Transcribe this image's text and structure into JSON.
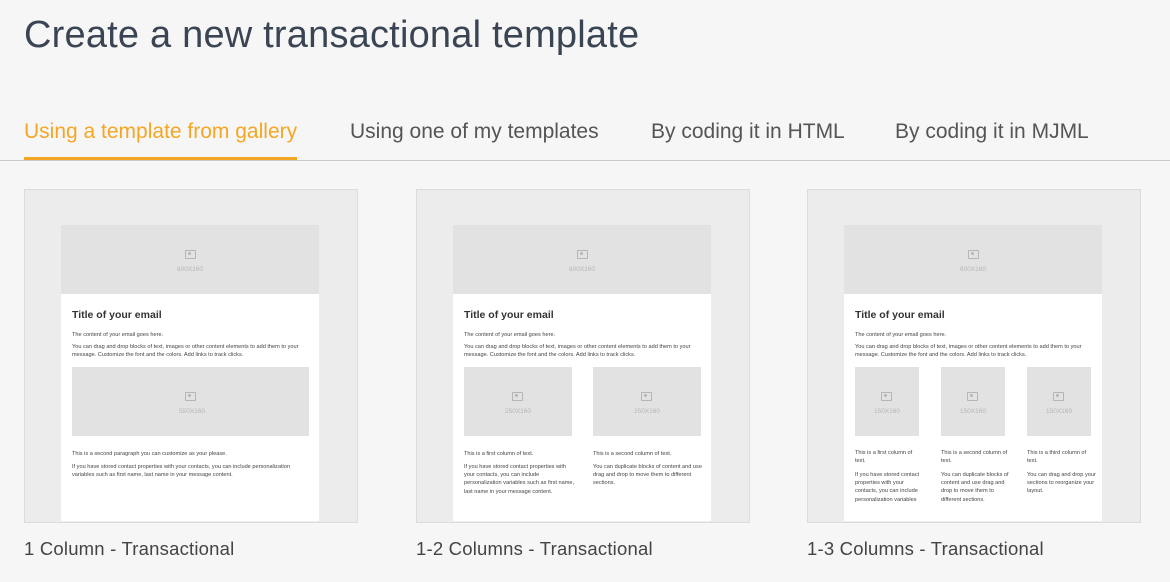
{
  "page": {
    "title": "Create a new transactional template"
  },
  "tabs": [
    {
      "label": "Using a template from gallery",
      "active": true
    },
    {
      "label": "Using one of my templates",
      "active": false
    },
    {
      "label": "By coding it in HTML",
      "active": false
    },
    {
      "label": "By coding it in MJML",
      "active": false
    }
  ],
  "colors": {
    "accent": "#f5a623",
    "title": "#3a4452"
  },
  "templates": [
    {
      "name": "1 Column - Transactional",
      "hero_size": "600X160",
      "email_title": "Title of your email",
      "intro": "The content of your email goes here.",
      "body": "You can drag and drop blocks of text, images or other content elements to add them to your message. Customize the font and the colors. Add links to track clicks.",
      "image_size": "550X160",
      "para2": "This is a second paragraph you can customize as your please.",
      "para3": "If you have stored contact properties with your contacts, you can include personalization variables such as first name, last name in your message content."
    },
    {
      "name": "1-2 Columns - Transactional",
      "hero_size": "600X160",
      "email_title": "Title of your email",
      "intro": "The content of your email goes here.",
      "body": "You can drag and drop blocks of text, images or other content elements to add them to your message. Customize the font and the colors. Add links to track clicks.",
      "col1_size": "250X160",
      "col2_size": "250X160",
      "col1_head": "This is a first column of text.",
      "col1_text": "If you have stored contact properties with your contacts, you can include personalization variables such as first name, last name in your message content.",
      "col2_head": "This is a second column of text.",
      "col2_text": "You can duplicate blocks of content and use drag and drop to move them to different sections."
    },
    {
      "name": "1-3 Columns - Transactional",
      "hero_size": "600X160",
      "email_title": "Title of your email",
      "intro": "The content of your email goes here.",
      "body": "You can drag and drop blocks of text, images or other content elements to add them to your message. Customize the font and the colors. Add links to track clicks.",
      "col1_size": "150X160",
      "col2_size": "150X160",
      "col3_size": "150X160",
      "col1_head": "This is a first column of text.",
      "col1_text": "If you have stored contact properties with your contacts, you can include personalization variables",
      "col2_head": "This is a second column of text.",
      "col2_text": "You can duplicate blocks of content and use drag and drop to move them to different sections.",
      "col3_head": "This is a third column of text.",
      "col3_text": "You can drag and drop your sections to reorganize your layout."
    }
  ]
}
